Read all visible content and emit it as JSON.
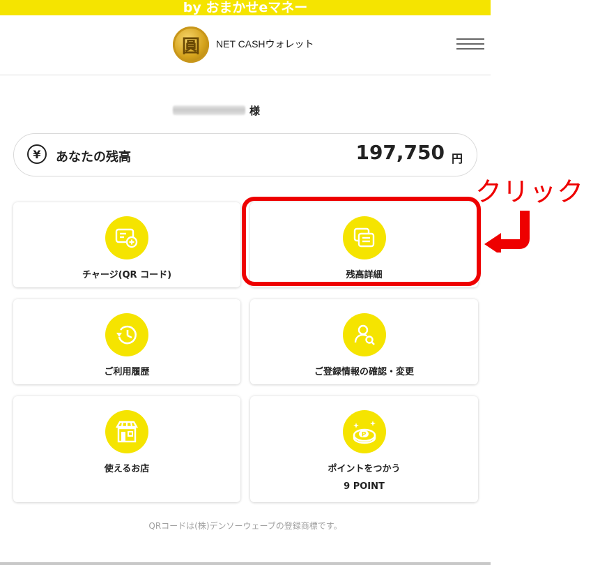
{
  "top_banner": {
    "text": "by おまかせeマネー"
  },
  "header": {
    "logo_glyph": "圓",
    "brand_name": "NET CASHウォレット"
  },
  "customer": {
    "honorific": "様"
  },
  "balance": {
    "label": "あなたの残高",
    "amount": "197,750",
    "unit": "円",
    "icon_glyph": "¥"
  },
  "tiles": [
    {
      "label": "チャージ(QR コード)",
      "icon": "card-plus-icon"
    },
    {
      "label": "残高詳細",
      "icon": "documents-icon"
    },
    {
      "label": "ご利用履歴",
      "icon": "history-clock-icon"
    },
    {
      "label": "ご登録情報の確認・変更",
      "icon": "user-search-icon"
    },
    {
      "label": "使えるお店",
      "icon": "store-icon"
    },
    {
      "label": "ポイントをつかう",
      "sub": "9 POINT",
      "icon": "point-coin-icon"
    }
  ],
  "annotation": {
    "text": "クリック"
  },
  "footnote": "QRコードは(株)デンソーウェーブの登録商標です。",
  "colors": {
    "accent": "#f5e400",
    "highlight": "#ee0000"
  }
}
